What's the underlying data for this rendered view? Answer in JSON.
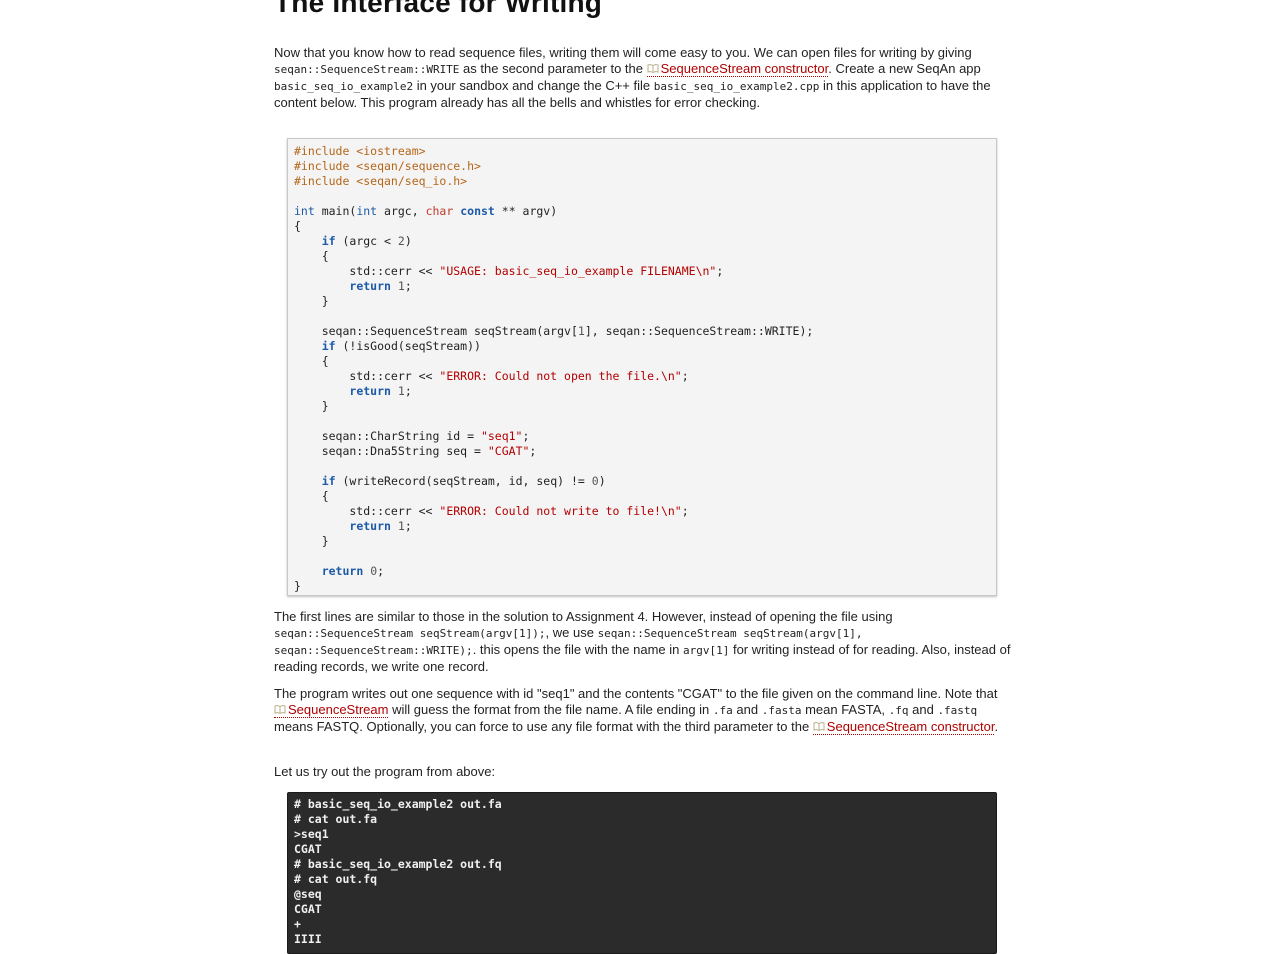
{
  "heading": "The Interface for Writing",
  "para1": {
    "t1": "Now that you know how to read sequence files, writing them will come easy to you. We can open files for writing by giving ",
    "c1": "seqan::SequenceStream::WRITE",
    "t2": " as the second parameter to the ",
    "link1": "SequenceStream constructor",
    "t3": ". Create a new SeqAn app ",
    "c2": "basic_seq_io_example2",
    "t4": " in your sandbox and change the C++ file ",
    "c3": "basic_seq_io_example2.cpp",
    "t5": " in this application to have the content below. This program already has all the bells and whistles for error checking."
  },
  "code_lines": [
    "#include <iostream>",
    "#include <seqan/sequence.h>",
    "#include <seqan/seq_io.h>",
    "",
    "int main(int argc, char const ** argv)",
    "{",
    "    if (argc < 2)",
    "    {",
    "        std::cerr << \"USAGE: basic_seq_io_example FILENAME\\n\";",
    "        return 1;",
    "    }",
    "",
    "    seqan::SequenceStream seqStream(argv[1], seqan::SequenceStream::WRITE);",
    "    if (!isGood(seqStream))",
    "    {",
    "        std::cerr << \"ERROR: Could not open the file.\\n\";",
    "        return 1;",
    "    }",
    "",
    "    seqan::CharString id = \"seq1\";",
    "    seqan::Dna5String seq = \"CGAT\";",
    "",
    "    if (writeRecord(seqStream, id, seq) != 0)",
    "    {",
    "        std::cerr << \"ERROR: Could not write to file!\\n\";",
    "        return 1;",
    "    }",
    "",
    "    return 0;",
    "}"
  ],
  "para2": {
    "t1": "The first lines are similar to those in the solution to Assignment 4. However, instead of opening the file using ",
    "c1": "seqan::SequenceStream seqStream(argv[1]);",
    "t2": ", we use ",
    "c2": "seqan::SequenceStream seqStream(argv[1], seqan::SequenceStream::WRITE);",
    "t3": ". this opens the file with the name in ",
    "c3": "argv[1]",
    "t4": " for writing instead of for reading. Also, instead of reading records, we write one record."
  },
  "para3": {
    "t1": "The program writes out one sequence with id \"seq1\" and the contents \"CGAT\" to the file given on the command line. Note that ",
    "link1": "SequenceStream",
    "t2": " will guess the format from the file name. A file ending in ",
    "c1": ".fa",
    "t3": " and ",
    "c2": ".fasta",
    "t4": " mean FASTA, ",
    "c3": ".fq",
    "t5": " and ",
    "c4": ".fastq",
    "t6": " means FASTQ. Optionally, you can force to use any file format with the third parameter to the ",
    "link2": "SequenceStream constructor",
    "t7": "."
  },
  "para4": "Let us try out the program from above:",
  "terminal_lines": [
    "# basic_seq_io_example2 out.fa",
    "# cat out.fa",
    ">seq1",
    "CGAT",
    "# basic_seq_io_example2 out.fq",
    "# cat out.fq",
    "@seq",
    "CGAT",
    "+",
    "IIII"
  ],
  "colors": {
    "link": "#b00000",
    "code_bg": "#f4f4f4",
    "terminal_bg": "#2b2b2b"
  }
}
